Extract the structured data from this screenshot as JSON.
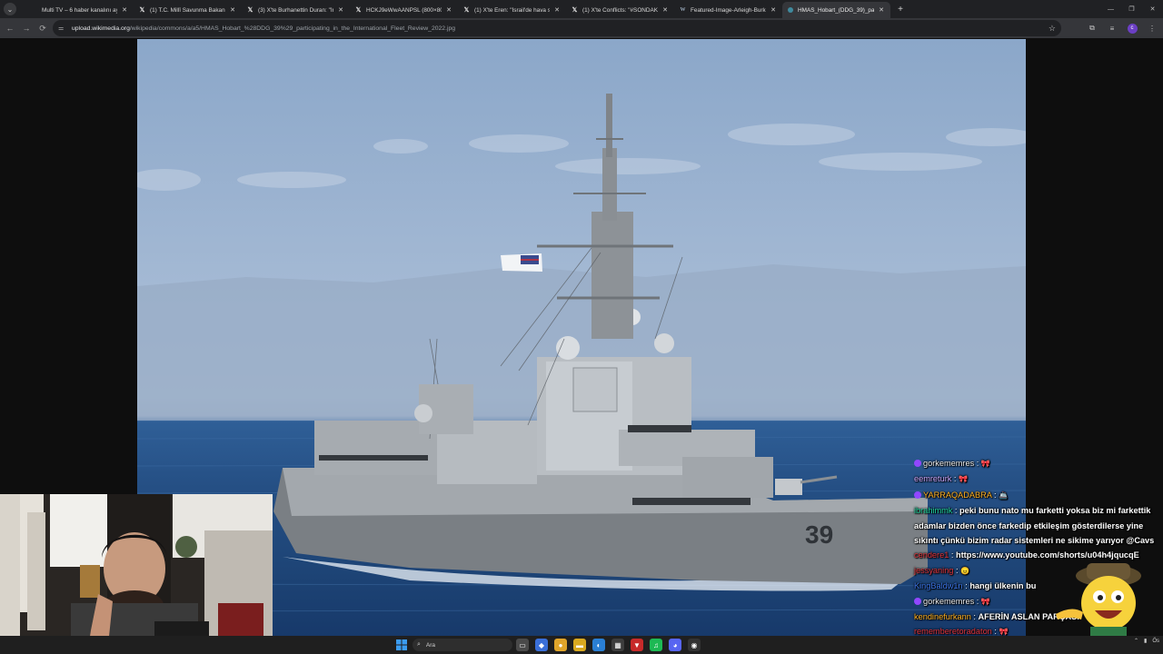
{
  "browser": {
    "tabs": [
      {
        "label": "Multi TV – 6 haber kanalını aynı anda izle",
        "icon": "blank-icon",
        "active": false
      },
      {
        "label": "(1) T.C. Millî Savunma Bakanlığı",
        "icon": "x-logo-icon",
        "active": false
      },
      {
        "label": "(3) X'te Burhanettin Duran: \"İran",
        "icon": "x-logo-icon",
        "active": false
      },
      {
        "label": "HCKJ9eWwAANPSL (800×800)",
        "icon": "x-logo-icon",
        "active": false
      },
      {
        "label": "(1) X'te Eren: \"İsrail'de hava sa",
        "icon": "x-logo-icon",
        "active": false
      },
      {
        "label": "(1) X'te Conflicts: \"#SONDAKİKA",
        "icon": "x-logo-icon",
        "active": false
      },
      {
        "label": "Featured-Image-Arleigh-Burke",
        "icon": "wordpress-icon",
        "active": false
      },
      {
        "label": "HMAS_Hobart_(DDG_39)_partic",
        "icon": "wikimedia-icon",
        "active": true
      }
    ],
    "url_domain": "upload.wikimedia.org",
    "url_path": "/wikipedia/commons/a/a5/HMAS_Hobart_%28DDG_39%29_participating_in_the_International_Fleet_Review_2022.jpg",
    "profile_initial": "c"
  },
  "photo": {
    "hull_number": "39"
  },
  "chat": [
    {
      "user": "gorkememres",
      "user_color": "#e8e8e8",
      "badge": true,
      "text": "",
      "emote": "bow-emote"
    },
    {
      "user": "eemreturk",
      "user_color": "#c9a8ff",
      "badge": false,
      "text": "",
      "emote": "bow-emote"
    },
    {
      "user": "YARRAQADABRA",
      "user_color": "#ffb020",
      "badge": true,
      "text": "",
      "emote": "ship-emote"
    },
    {
      "user": "ibrahimmk",
      "user_color": "#1fd7a0",
      "badge": false,
      "text": "peki bunu nato mu farketti yoksa biz mi farkettik adamlar bizden önce farkedip etkileşim gösterdilerse yine sıkıntı çünkü bizim radar sistemleri ne sikime yarıyor @Cavs",
      "emote": ""
    },
    {
      "user": "cendere1",
      "user_color": "#e0353d",
      "badge": false,
      "text": "https://www.youtube.com/shorts/u04h4jqucqE",
      "emote": ""
    },
    {
      "user": "jessyaning",
      "user_color": "#e0353d",
      "badge": false,
      "text": "",
      "emote": "angry-emote"
    },
    {
      "user": "KingBaldw1n",
      "user_color": "#3b74e6",
      "badge": false,
      "text": "hangi ülkenin bu",
      "emote": ""
    },
    {
      "user": "gorkememres",
      "user_color": "#e8e8e8",
      "badge": true,
      "text": "",
      "emote": "bow-emote"
    },
    {
      "user": "kendinefurkann",
      "user_color": "#ffb020",
      "badge": false,
      "text": "AFERİN ASLAN PARÇASI",
      "emote": ""
    },
    {
      "user": "rememberetoradaton",
      "user_color": "#e0353d",
      "badge": false,
      "text": "",
      "emote": "bow-emote"
    }
  ],
  "taskbar": {
    "search_placeholder": "Ara",
    "time": "Ös"
  },
  "colors": {
    "chrome_bg": "#202124",
    "toolbar_bg": "#35363a",
    "accent_twitch": "#9147ff"
  }
}
